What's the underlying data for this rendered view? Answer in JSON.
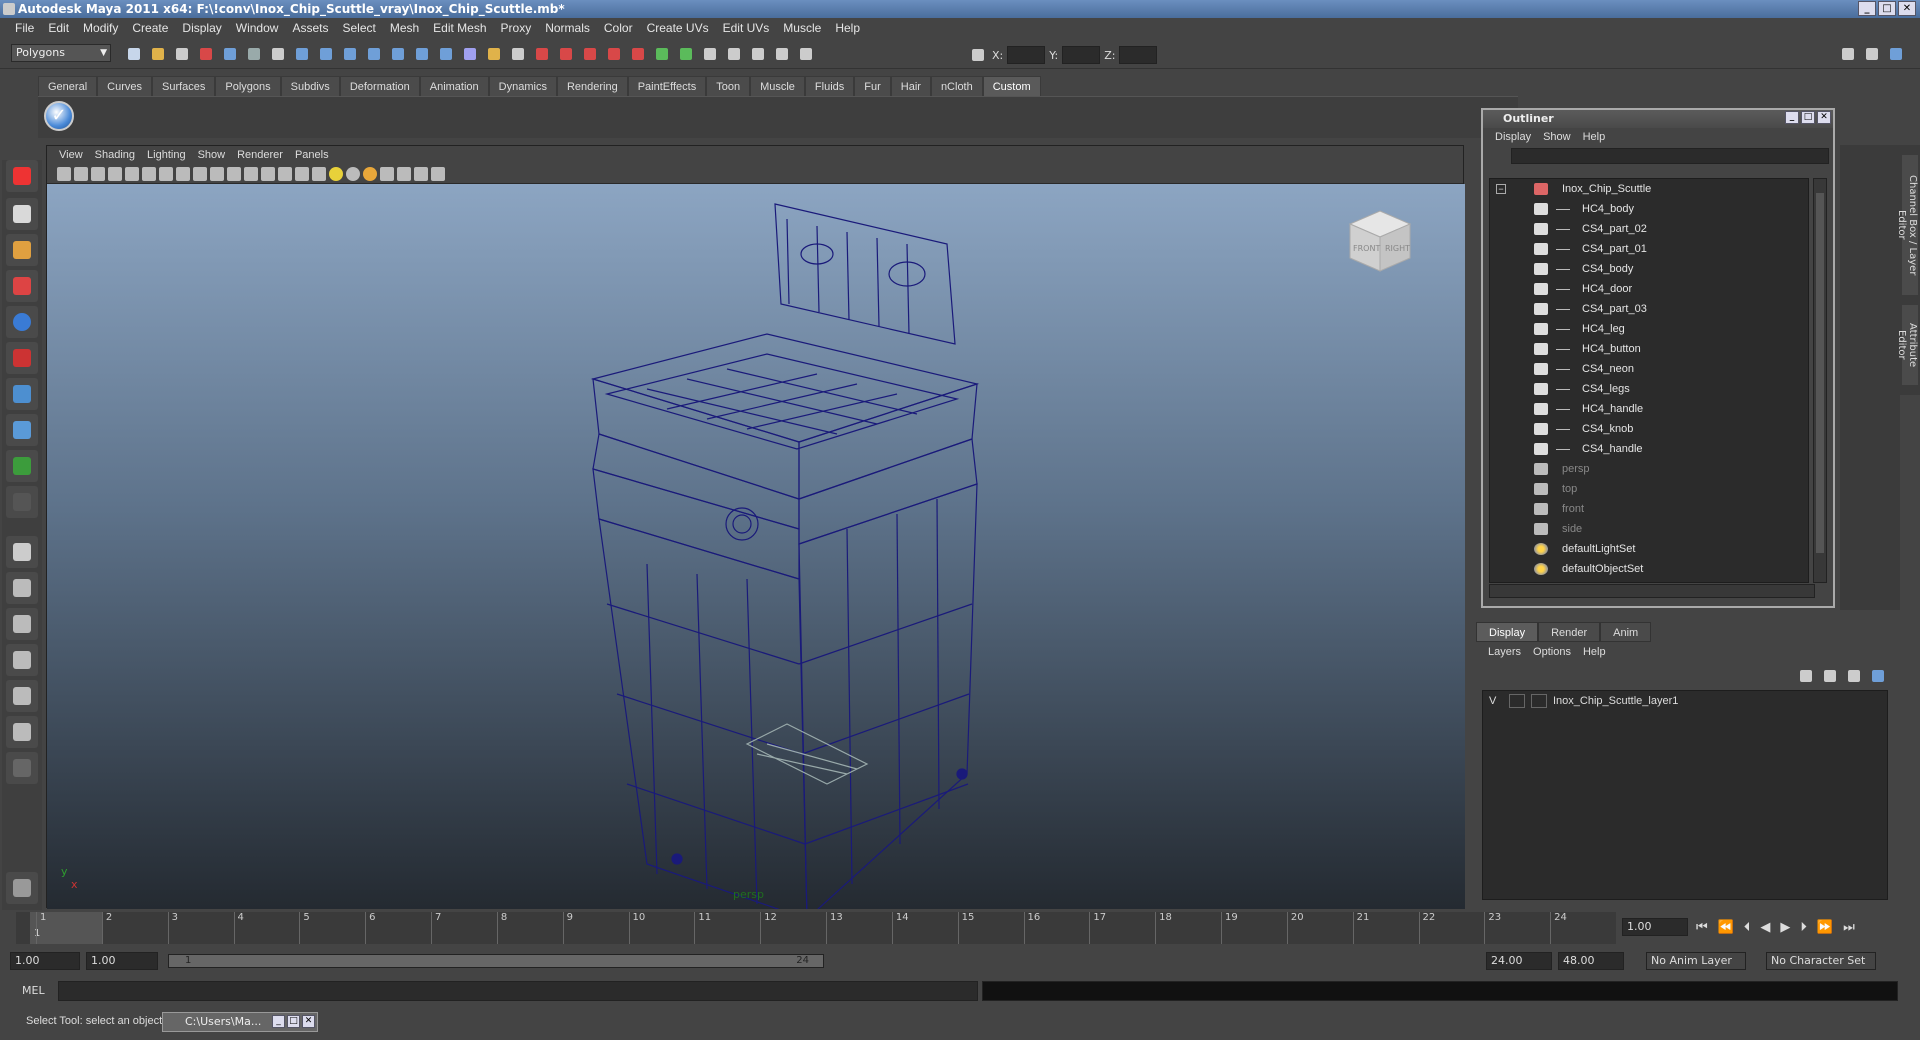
{
  "window": {
    "title": "Autodesk Maya 2011 x64: F:\\!conv\\Inox_Chip_Scuttle_vray\\Inox_Chip_Scuttle.mb*",
    "min": "_",
    "max": "□",
    "close": "✕"
  },
  "menubar": [
    "File",
    "Edit",
    "Modify",
    "Create",
    "Display",
    "Window",
    "Assets",
    "Select",
    "Mesh",
    "Edit Mesh",
    "Proxy",
    "Normals",
    "Color",
    "Create UVs",
    "Edit UVs",
    "Muscle",
    "Help"
  ],
  "status": {
    "mode": "Polygons",
    "x_label": "X:",
    "y_label": "Y:",
    "z_label": "Z:",
    "x": "",
    "y": "",
    "z": ""
  },
  "shelf_tabs": [
    "General",
    "Curves",
    "Surfaces",
    "Polygons",
    "Subdivs",
    "Deformation",
    "Animation",
    "Dynamics",
    "Rendering",
    "PaintEffects",
    "Toon",
    "Muscle",
    "Fluids",
    "Fur",
    "Hair",
    "nCloth",
    "Custom"
  ],
  "shelf_active": "Custom",
  "viewport": {
    "menu": [
      "View",
      "Shading",
      "Lighting",
      "Show",
      "Renderer",
      "Panels"
    ],
    "camera": "persp",
    "cube_front": "FRONT",
    "cube_right": "RIGHT",
    "axis_y": "y",
    "axis_x": "x"
  },
  "outliner": {
    "title": "Outliner",
    "menu": [
      "Display",
      "Show",
      "Help"
    ],
    "root": "Inox_Chip_Scuttle",
    "children": [
      "HC4_body",
      "CS4_part_02",
      "CS4_part_01",
      "CS4_body",
      "HC4_door",
      "CS4_part_03",
      "HC4_leg",
      "HC4_button",
      "CS4_neon",
      "CS4_legs",
      "HC4_handle",
      "CS4_knob",
      "CS4_handle"
    ],
    "cameras": [
      "persp",
      "top",
      "front",
      "side"
    ],
    "sets": [
      "defaultLightSet",
      "defaultObjectSet"
    ]
  },
  "sidetabs": [
    "Channel Box / Layer Editor",
    "Attribute Editor"
  ],
  "layers": {
    "tabs": [
      "Display",
      "Render",
      "Anim"
    ],
    "menu": [
      "Layers",
      "Options",
      "Help"
    ],
    "rows": [
      {
        "v": "V",
        "name": "Inox_Chip_Scuttle_layer1"
      }
    ]
  },
  "timeline": {
    "ticks": [
      "1",
      "2",
      "3",
      "4",
      "5",
      "6",
      "7",
      "8",
      "9",
      "10",
      "11",
      "12",
      "13",
      "14",
      "15",
      "16",
      "17",
      "18",
      "19",
      "20",
      "21",
      "22",
      "23",
      "24"
    ],
    "marker": "1",
    "current": "1.00"
  },
  "range": {
    "start": "1.00",
    "playstart": "1.00",
    "slider_start": "1",
    "slider_end": "24",
    "playend": "24.00",
    "end": "48.00",
    "anim_layer": "No Anim Layer",
    "char_set": "No Character Set"
  },
  "cmd": {
    "label": "MEL"
  },
  "help": {
    "text": "Select Tool: select an object",
    "task": "C:\\Users\\Ma..."
  },
  "colors": {
    "accent": "#5b87c4",
    "wire": "#1a1a7a",
    "viewport_top": "#8ca5c2",
    "viewport_bottom": "#242a31"
  }
}
